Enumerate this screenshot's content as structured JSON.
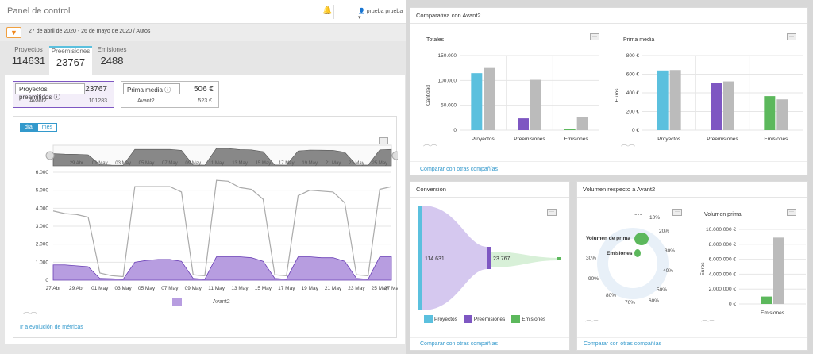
{
  "header": {
    "title": "Panel de control",
    "user": "prueba prueba"
  },
  "filter": {
    "text": "27 de abril de 2020 - 26 de mayo de 2020 / Autos"
  },
  "tabs": [
    {
      "label": "Proyectos",
      "value": "114631"
    },
    {
      "label": "Preemisiones",
      "value": "23767"
    },
    {
      "label": "Emisiones",
      "value": "2488"
    }
  ],
  "kpis": {
    "preemitidos": {
      "label": "Proyectos preemitidos",
      "value": "23767",
      "sub_label": "Avant2",
      "sub_value": "101283"
    },
    "prima": {
      "label": "Prima media",
      "value": "506 €",
      "sub_label": "Avant2",
      "sub_value": "523 €"
    }
  },
  "main_chart": {
    "toggle_day": "día",
    "toggle_month": "mes",
    "nav_ticks": [
      "29 Abr",
      "01 May",
      "03 May",
      "05 May",
      "07 May",
      "09 May",
      "11 May",
      "13 May",
      "15 May",
      "17 May",
      "19 May",
      "21 May",
      "23 May",
      "25 May"
    ],
    "x_ticks": [
      "27 Abr",
      "29 Abr",
      "01 May",
      "03 May",
      "05 May",
      "07 May",
      "09 May",
      "11 May",
      "13 May",
      "15 May",
      "17 May",
      "19 May",
      "21 May",
      "23 May",
      "25 May",
      "27 Ma"
    ],
    "y_ticks": [
      "0",
      "1.000",
      "2.000",
      "3.000",
      "4.000",
      "5.000",
      "6.000"
    ],
    "legend_avant": "Avant2",
    "link": "Ir a evolución de métricas"
  },
  "chart_data": [
    {
      "type": "area",
      "x": [
        "27 Abr",
        "28 Abr",
        "29 Abr",
        "30 Abr",
        "01 May",
        "02 May",
        "03 May",
        "04 May",
        "05 May",
        "06 May",
        "07 May",
        "08 May",
        "09 May",
        "10 May",
        "11 May",
        "12 May",
        "13 May",
        "14 May",
        "15 May",
        "16 May",
        "17 May",
        "18 May",
        "19 May",
        "20 May",
        "21 May",
        "22 May",
        "23 May",
        "24 May",
        "25 May",
        "26 May",
        "27 May"
      ],
      "series": [
        {
          "color": "#a685d8",
          "values": [
            850,
            850,
            800,
            750,
            100,
            80,
            50,
            1000,
            1100,
            1150,
            1150,
            1050,
            100,
            50,
            1300,
            1300,
            1300,
            1250,
            1050,
            100,
            50,
            1300,
            1300,
            1250,
            1250,
            1050,
            100,
            50,
            1300,
            1300
          ]
        },
        {
          "name": "Avant2",
          "color": "#aaaaaa",
          "values": [
            3850,
            3700,
            3650,
            3500,
            400,
            250,
            200,
            5200,
            5200,
            5200,
            5200,
            4900,
            300,
            250,
            5550,
            5500,
            5150,
            5050,
            4500,
            300,
            250,
            4700,
            5000,
            4950,
            4900,
            4300,
            300,
            250,
            5050,
            5200
          ]
        }
      ],
      "ylim": [
        0,
        6000
      ]
    },
    {
      "type": "bar",
      "title": "Totales",
      "ylabel": "Cantidad",
      "categories": [
        "Proyectos",
        "Preemisiones",
        "Emisiones"
      ],
      "series": [
        {
          "values": [
            114631,
            23767,
            2488
          ]
        },
        {
          "name": "Avant2",
          "values": [
            125000,
            101283,
            26000
          ]
        }
      ],
      "y_ticks": [
        "0",
        "50.000",
        "100.000",
        "150.000"
      ],
      "ylim": [
        0,
        150000
      ]
    },
    {
      "type": "bar",
      "title": "Prima media",
      "ylabel": "Euros",
      "categories": [
        "Proyectos",
        "Preemisiones",
        "Emisiones"
      ],
      "series": [
        {
          "values": [
            640,
            506,
            365
          ]
        },
        {
          "name": "Avant2",
          "values": [
            645,
            523,
            330
          ]
        }
      ],
      "y_ticks": [
        "0 €",
        "200 €",
        "400 €",
        "600 €",
        "800 €"
      ],
      "ylim": [
        0,
        800
      ]
    },
    {
      "type": "bar",
      "title": "Volumen prima",
      "ylabel": "Euros",
      "categories": [
        "Emisiones"
      ],
      "series": [
        {
          "values": [
            1000000
          ]
        },
        {
          "name": "Avant2",
          "values": [
            8900000
          ]
        }
      ],
      "y_ticks": [
        "0 €",
        "2.000.000 €",
        "4.000.000 €",
        "6.000.000 €",
        "8.000.000 €",
        "10.000.000 €"
      ],
      "ylim": [
        0,
        10000000
      ]
    }
  ],
  "comparativa": {
    "title": "Comparativa con Avant2",
    "link": "Comparar con otras compañías"
  },
  "conversion": {
    "title": "Conversión",
    "v1": "114.631",
    "v2": "23.767",
    "legend": [
      "Proyectos",
      "Preemisiones",
      "Emisiones"
    ],
    "link": "Comparar con otras compañías"
  },
  "volumen": {
    "title": "Volumen respecto a Avant2",
    "label_prima": "Volumen de prima",
    "label_emis": "Emisiones",
    "pct_right": [
      "0%",
      "10%",
      "20%",
      "30%",
      "40%",
      "50%",
      "60%",
      "70%",
      "80%",
      "90%",
      "30%"
    ],
    "link": "Comparar con otras compañías"
  },
  "colors": {
    "proyectos": "#5bc0de",
    "preemisiones": "#7e57c2",
    "emisiones": "#5cb85c",
    "avant": "#bbbbbb",
    "accent": "#3399cc"
  }
}
